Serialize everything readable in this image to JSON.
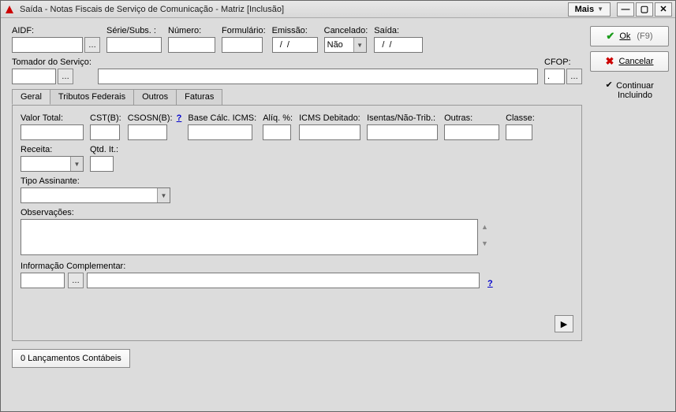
{
  "window": {
    "title": "Saída - Notas Fiscais de Serviço de Comunicação - Matriz [Inclusão]",
    "more_button": "Mais"
  },
  "actions": {
    "ok_label": "Ok",
    "ok_shortcut": "(F9)",
    "cancel_label": "Cancelar",
    "continue_label": "Continuar",
    "continue_label2": "Incluindo"
  },
  "top_fields": {
    "aidf_label": "AIDF:",
    "aidf_value": "",
    "serie_label": "Série/Subs. :",
    "serie_value": "",
    "numero_label": "Número:",
    "numero_value": "",
    "formulario_label": "Formulário:",
    "formulario_value": "",
    "emissao_label": "Emissão:",
    "emissao_value": "  /  /",
    "cancelado_label": "Cancelado:",
    "cancelado_value": "Não",
    "saida_label": "Saída:",
    "saida_value": "  /  /"
  },
  "tomador": {
    "label": "Tomador do Serviço:",
    "code": "",
    "desc": "",
    "cfop_label": "CFOP:",
    "cfop_value": "."
  },
  "tabs": {
    "geral": "Geral",
    "tributos": "Tributos Federais",
    "outros": "Outros",
    "faturas": "Faturas"
  },
  "geral": {
    "valor_total_label": "Valor Total:",
    "valor_total": "",
    "cst_label": "CST(B):",
    "cst": "",
    "csosn_label": "CSOSN(B):",
    "csosn": "",
    "help": "?",
    "base_calc_label": "Base Cálc. ICMS:",
    "base_calc": "",
    "aliq_label": "Alíq. %:",
    "aliq": "",
    "icms_deb_label": "ICMS Debitado:",
    "icms_deb": "",
    "isentas_label": "Isentas/Não-Trib.:",
    "isentas": "",
    "outras_label": "Outras:",
    "outras": "",
    "classe_label": "Classe:",
    "classe": "",
    "receita_label": "Receita:",
    "receita": "",
    "qtd_label": "Qtd. It.:",
    "qtd": "",
    "tipo_assinante_label": "Tipo Assinante:",
    "tipo_assinante": "",
    "observacoes_label": "Observações:",
    "observacoes": "",
    "info_comp_label": "Informação Complementar:",
    "info_comp_code": "",
    "info_comp_desc": "",
    "info_help": "?"
  },
  "footer": {
    "lancamentos": "0 Lançamentos Contábeis"
  }
}
